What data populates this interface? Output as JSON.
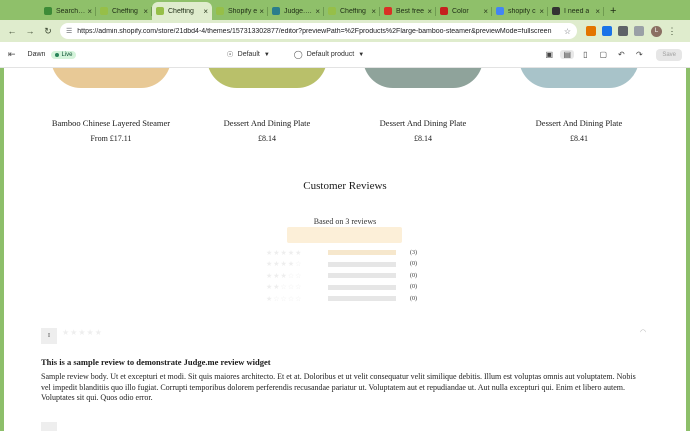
{
  "browser": {
    "tabs": [
      {
        "label": "Search re",
        "favicon_color": "#3d8b37"
      },
      {
        "label": "Cheffing",
        "favicon_color": "#96bf48"
      },
      {
        "label": "Cheffing",
        "favicon_color": "#96bf48",
        "active": true
      },
      {
        "label": "Shopify e",
        "favicon_color": "#96bf48"
      },
      {
        "label": "Judge.me",
        "favicon_color": "#2a7d8c"
      },
      {
        "label": "Cheffing",
        "favicon_color": "#96bf48"
      },
      {
        "label": "Best free",
        "favicon_color": "#d93025"
      },
      {
        "label": "Color",
        "favicon_color": "#c5221f"
      },
      {
        "label": "shopify c",
        "favicon_color": "#4285f4"
      },
      {
        "label": "I need a",
        "favicon_color": "#333333"
      }
    ],
    "url": "https://admin.shopify.com/store/21dbd4-4/themes/157313302877/editor?previewPath=%2Fproducts%2Flarge-bamboo-steamer&previewMode=fullscreen",
    "profile_initial": "L"
  },
  "editor": {
    "theme_name": "Dawn",
    "live_label": "Live",
    "template_select": "Default",
    "product_select": "Default product",
    "save_label": "Save"
  },
  "products": [
    {
      "title": "Bamboo Chinese Layered Steamer",
      "price": "From £17.11",
      "img_color": "#e8c996"
    },
    {
      "title": "Dessert And Dining Plate",
      "price": "£8.14",
      "img_color": "#b9c06a"
    },
    {
      "title": "Dessert And Dining Plate",
      "price": "£8.14",
      "img_color": "#8fa39b"
    },
    {
      "title": "Dessert And Dining Plate",
      "price": "£8.41",
      "img_color": "#a8c3c9"
    }
  ],
  "reviews": {
    "heading": "Customer Reviews",
    "based_on": "Based on 3 reviews",
    "histogram": [
      {
        "stars": 5,
        "count": "(3)",
        "fraction": 1.0
      },
      {
        "stars": 4,
        "count": "(0)",
        "fraction": 0
      },
      {
        "stars": 3,
        "count": "(0)",
        "fraction": 0
      },
      {
        "stars": 2,
        "count": "(0)",
        "fraction": 0
      },
      {
        "stars": 1,
        "count": "(0)",
        "fraction": 0
      }
    ],
    "first_review": {
      "avatar_initial": "I",
      "title": "This is a sample review to demonstrate Judge.me review widget",
      "body": "Sample review body. Ut et excepturi et modi. Sit quis maiores architecto. Et et at. Doloribus et ut velit consequatur velit similique debitis. Illum est voluptas omnis aut voluptatem. Nobis vel impedit blanditiis quo illo fugiat. Corrupti temporibus dolorem perferendis recusandae pariatur ut. Voluptatem aut et repudiandae ut. Aut nulla excepturi qui. Enim et libero autem. Voluptates sit qui. Quos odio error."
    }
  }
}
